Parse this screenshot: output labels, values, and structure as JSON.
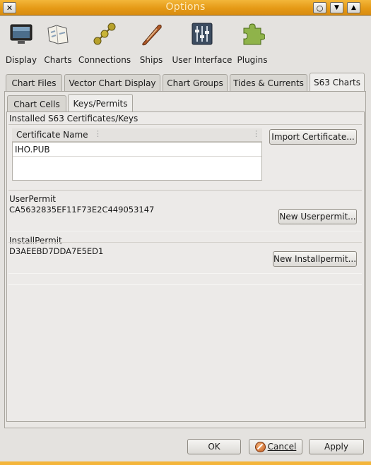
{
  "window": {
    "title": "Options",
    "close_glyph": "✕",
    "menu_glyph": "○",
    "minimize_glyph": "▼",
    "maximize_glyph": "▲"
  },
  "toolbar": [
    {
      "label": "Display",
      "icon": "display-icon"
    },
    {
      "label": "Charts",
      "icon": "charts-icon"
    },
    {
      "label": "Connections",
      "icon": "connections-icon"
    },
    {
      "label": "Ships",
      "icon": "ships-icon"
    },
    {
      "label": "User Interface",
      "icon": "user-interface-icon"
    },
    {
      "label": "Plugins",
      "icon": "plugins-icon"
    }
  ],
  "tabs": [
    "Chart Files",
    "Vector Chart Display",
    "Chart Groups",
    "Tides & Currents",
    "S63 Charts"
  ],
  "active_tab": "S63 Charts",
  "subtabs": [
    "Chart Cells",
    "Keys/Permits"
  ],
  "active_subtab": "Keys/Permits",
  "certificates": {
    "group_label": "Installed S63 Certificates/Keys",
    "column_header": "Certificate Name",
    "rows": [
      "IHO.PUB"
    ],
    "import_button": "Import Certificate..."
  },
  "user_permit": {
    "label": "UserPermit",
    "value": "CA5632835EF11F73E2C449053147",
    "button": "New Userpermit..."
  },
  "install_permit": {
    "label": "InstallPermit",
    "value": "D3AEEBD7DDA7E5ED1",
    "button": "New Installpermit..."
  },
  "footer": {
    "ok": "OK",
    "cancel": "Cancel",
    "apply": "Apply"
  }
}
